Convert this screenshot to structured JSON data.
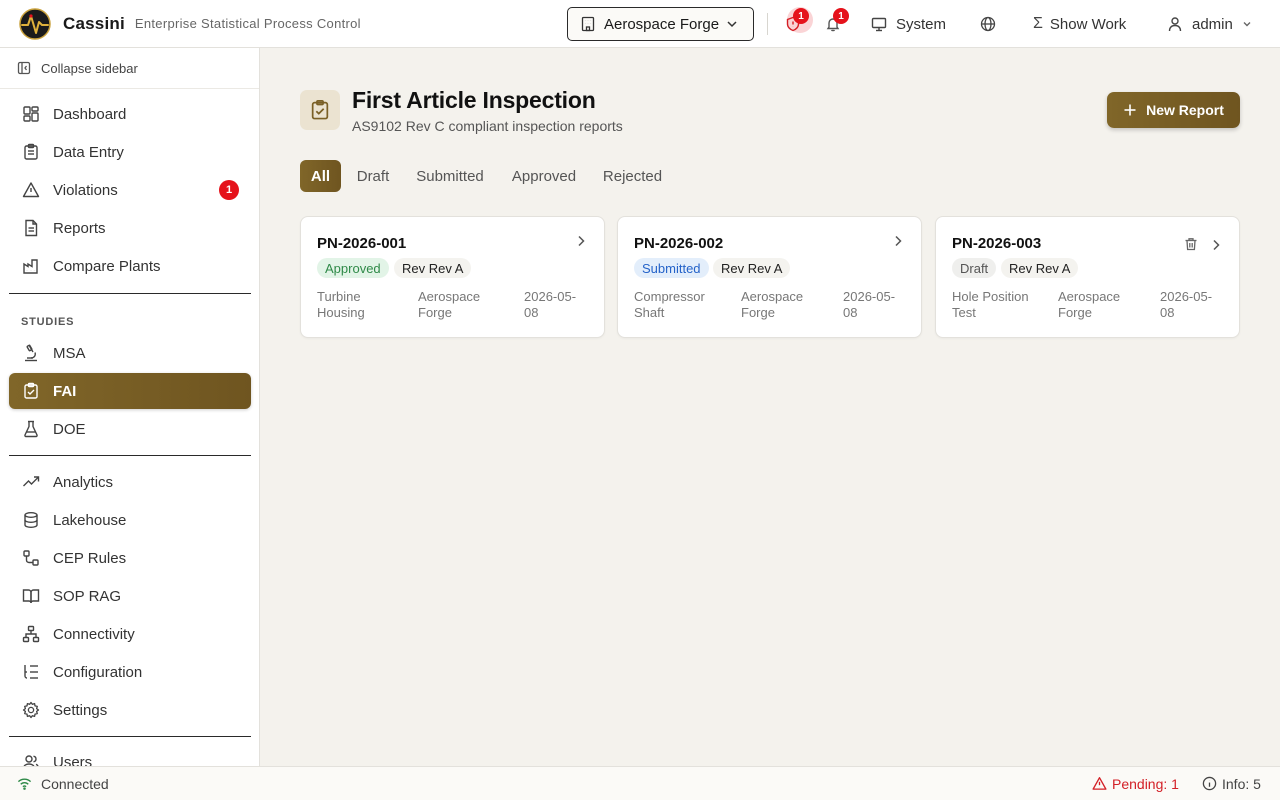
{
  "app": {
    "name": "Cassini",
    "subtitle": "Enterprise Statistical Process Control"
  },
  "header": {
    "plant": "Aerospace Forge",
    "alert_count": "1",
    "notification_count": "1",
    "system_label": "System",
    "show_work_label": "Show Work",
    "user_label": "admin"
  },
  "sidebar": {
    "collapse_label": "Collapse sidebar",
    "primary": [
      {
        "label": "Dashboard",
        "icon": "dashboard-icon"
      },
      {
        "label": "Data Entry",
        "icon": "clipboard-icon"
      },
      {
        "label": "Violations",
        "icon": "warning-icon",
        "count": "1"
      },
      {
        "label": "Reports",
        "icon": "document-icon"
      },
      {
        "label": "Compare Plants",
        "icon": "factory-icon"
      }
    ],
    "studies_label": "STUDIES",
    "studies": [
      {
        "label": "MSA",
        "icon": "microscope-icon"
      },
      {
        "label": "FAI",
        "icon": "clipboard-check-icon",
        "active": true
      },
      {
        "label": "DOE",
        "icon": "flask-icon"
      }
    ],
    "tools": [
      {
        "label": "Analytics",
        "icon": "trend-icon"
      },
      {
        "label": "Lakehouse",
        "icon": "database-icon"
      },
      {
        "label": "CEP Rules",
        "icon": "workflow-icon"
      },
      {
        "label": "SOP RAG",
        "icon": "book-icon"
      },
      {
        "label": "Connectivity",
        "icon": "network-icon"
      },
      {
        "label": "Configuration",
        "icon": "list-tree-icon"
      },
      {
        "label": "Settings",
        "icon": "gear-icon"
      }
    ],
    "admin": [
      {
        "label": "Users",
        "icon": "users-icon"
      }
    ]
  },
  "page": {
    "title": "First Article Inspection",
    "subtitle": "AS9102 Rev C compliant inspection reports",
    "new_button": "New Report",
    "tabs": [
      "All",
      "Draft",
      "Submitted",
      "Approved",
      "Rejected"
    ],
    "active_tab": "All"
  },
  "reports": [
    {
      "part_number": "PN-2026-001",
      "status": "Approved",
      "revision": "Rev Rev A",
      "part_name": "Turbine Housing",
      "plant": "Aerospace Forge",
      "date": "2026-05-08"
    },
    {
      "part_number": "PN-2026-002",
      "status": "Submitted",
      "revision": "Rev Rev A",
      "part_name": "Compressor Shaft",
      "plant": "Aerospace Forge",
      "date": "2026-05-08"
    },
    {
      "part_number": "PN-2026-003",
      "status": "Draft",
      "revision": "Rev Rev A",
      "part_name": "Hole Position Test",
      "plant": "Aerospace Forge",
      "date": "2026-05-08"
    }
  ],
  "statusbar": {
    "connection": "Connected",
    "pending": "Pending: 1",
    "info": "Info: 5"
  },
  "colors": {
    "accent": "#7a6026",
    "danger": "#e5121b",
    "approved": "#2f8a48",
    "submitted": "#2563c9"
  }
}
